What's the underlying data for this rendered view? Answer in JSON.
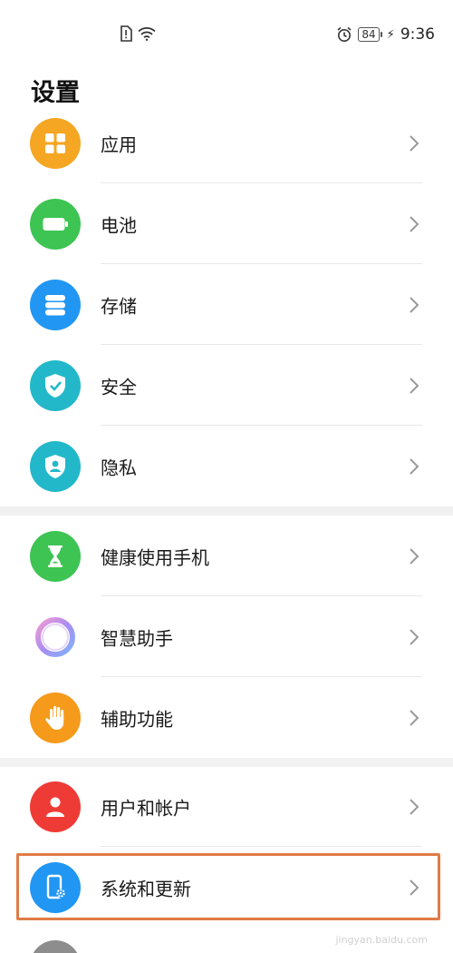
{
  "status_bar": {
    "time": "9:36",
    "battery": "84",
    "icons": [
      "sim-alert-icon",
      "wifi-icon",
      "alarm-icon",
      "battery-icon",
      "charging-icon"
    ]
  },
  "page_title": "设置",
  "groups": [
    [
      {
        "label": "应用",
        "icon": "apps-icon",
        "color": "#f5a623"
      },
      {
        "label": "电池",
        "icon": "battery-icon",
        "color": "#3dc453"
      },
      {
        "label": "存储",
        "icon": "storage-icon",
        "color": "#2196f3"
      },
      {
        "label": "安全",
        "icon": "shield-check-icon",
        "color": "#22b8c9"
      },
      {
        "label": "隐私",
        "icon": "privacy-shield-icon",
        "color": "#22b8c9"
      }
    ],
    [
      {
        "label": "健康使用手机",
        "icon": "hourglass-icon",
        "color": "#3dc453"
      },
      {
        "label": "智慧助手",
        "icon": "assistant-ring-icon",
        "color": "#ffffff"
      },
      {
        "label": "辅助功能",
        "icon": "hand-icon",
        "color": "#f59a1b"
      }
    ],
    [
      {
        "label": "用户和帐户",
        "icon": "user-icon",
        "color": "#ef3b36"
      },
      {
        "label": "系统和更新",
        "icon": "phone-gear-icon",
        "color": "#2196f3"
      }
    ]
  ],
  "highlight_color": "#e07b47",
  "watermark": "jingyan.baidu.com"
}
